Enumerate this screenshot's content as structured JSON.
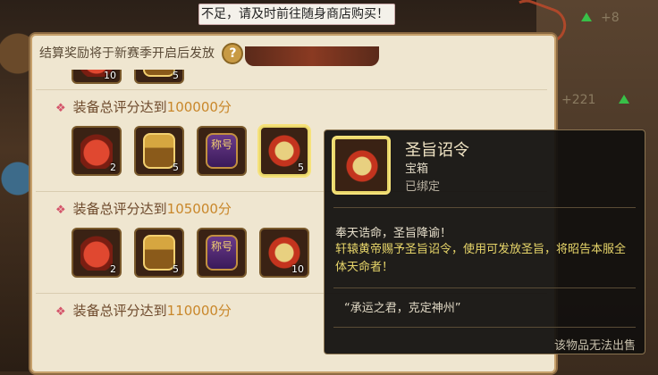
{
  "notice": {
    "text": "不足，请及时前往随身商店购买！"
  },
  "background": {
    "stat_top": "+8",
    "stat_mid": "+221"
  },
  "reward_panel": {
    "header": "结算奖励将于新赛季开启后发放",
    "help_icon": "?",
    "top_partial_items": [
      {
        "icon": "red-bag-icon",
        "count": "10"
      },
      {
        "icon": "gold-chest-icon",
        "count": "5"
      }
    ],
    "tiers": [
      {
        "label_prefix": "装备总评分达到",
        "score": "100000分",
        "items": [
          {
            "icon": "red-bag-icon",
            "count": "2"
          },
          {
            "icon": "gold-chest-icon",
            "count": "5"
          },
          {
            "icon": "title-plaque-icon",
            "text": "称号",
            "count": ""
          },
          {
            "icon": "edict-scroll-icon",
            "count": "5"
          }
        ]
      },
      {
        "label_prefix": "装备总评分达到",
        "score": "105000分",
        "items": [
          {
            "icon": "red-bag-icon",
            "count": "2"
          },
          {
            "icon": "gold-chest-icon",
            "count": "5"
          },
          {
            "icon": "title-plaque-icon",
            "text": "称号",
            "count": ""
          },
          {
            "icon": "edict-scroll-icon",
            "count": "10"
          }
        ]
      },
      {
        "label_prefix": "装备总评分达到",
        "score": "110000分",
        "items": []
      }
    ]
  },
  "tooltip": {
    "name": "圣旨诏令",
    "type": "宝箱",
    "bound": "已绑定",
    "desc1": "奉天诰命，圣旨降谕！",
    "desc2": "轩辕黄帝赐予圣旨诏令，使用可发放圣旨，将昭告本服全体天命者！",
    "quote": "“承运之君，克定神州”",
    "footer": "该物品无法出售"
  }
}
